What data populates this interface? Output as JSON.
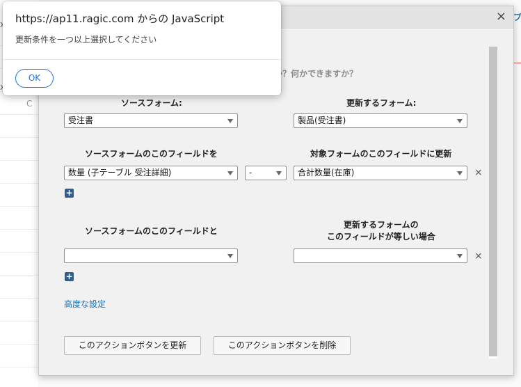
{
  "alert": {
    "title": "https://ap11.ragic.com からの JavaScript",
    "message": "更新条件を一つ以上選択してください",
    "ok_label": "OK"
  },
  "background": {
    "link_fragment": "プ",
    "c_fragment": "C",
    "x_fragment": "x"
  },
  "modal": {
    "close_symbol": "×",
    "question_text": "か？何かできますか？",
    "section1": {
      "source_form_label": "ソースフォーム:",
      "target_form_label": "更新するフォーム:",
      "source_form_value": "受注書",
      "target_form_value": "製品(受注書)"
    },
    "section2": {
      "source_field_label": "ソースフォームのこのフィールドを",
      "target_field_label": "対象フォームのこのフィールドに更新",
      "source_field_value": "数量 (子テーブル 受注詳細)",
      "operator_value": "-",
      "target_field_value": "合計数量(在庫)",
      "remove_symbol": "×",
      "add_symbol": "+"
    },
    "section3": {
      "source_match_label": "ソースフォームのこのフィールドと",
      "target_match_label_line1": "更新するフォームの",
      "target_match_label_line2": "このフィールドが等しい場合",
      "source_match_value": "",
      "target_match_value": "",
      "remove_symbol": "×",
      "add_symbol": "+"
    },
    "advanced_link": "高度な設定",
    "update_button": "このアクションボタンを更新",
    "delete_button": "このアクションボタンを削除"
  }
}
